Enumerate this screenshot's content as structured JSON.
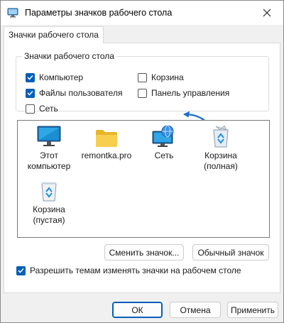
{
  "window": {
    "title": "Параметры значков рабочего стола",
    "icon": "desktop-settings-icon"
  },
  "tabs": [
    {
      "label": "Значки рабочего стола",
      "selected": true
    }
  ],
  "desktop_icons_group": {
    "legend": "Значки рабочего стола",
    "checkboxes": [
      {
        "label": "Компьютер",
        "checked": true
      },
      {
        "label": "Корзина",
        "checked": false
      },
      {
        "label": "Файлы пользователя",
        "checked": true
      },
      {
        "label": "Панель управления",
        "checked": false
      },
      {
        "label": "Сеть",
        "checked": false
      }
    ]
  },
  "icons": [
    {
      "label_line1": "Этот",
      "label_line2": "компьютер",
      "icon": "monitor-icon"
    },
    {
      "label_line1": "remontka.pro",
      "label_line2": "",
      "icon": "folder-icon"
    },
    {
      "label_line1": "Сеть",
      "label_line2": "",
      "icon": "network-globe-icon"
    },
    {
      "label_line1": "Корзина",
      "label_line2": "(полная)",
      "icon": "recycle-bin-full-icon"
    },
    {
      "label_line1": "Корзина",
      "label_line2": "(пустая)",
      "icon": "recycle-bin-empty-icon"
    }
  ],
  "buttons": {
    "change_icon": "Сменить значок...",
    "default_icon": "Обычный значок",
    "ok": "ОК",
    "cancel": "Отмена",
    "apply": "Применить"
  },
  "allow_themes": {
    "label": "Разрешить темам изменять значки на рабочем столе",
    "checked": true
  },
  "colors": {
    "accent": "#005fb8",
    "annotation_arrow": "#1a6fd0"
  }
}
